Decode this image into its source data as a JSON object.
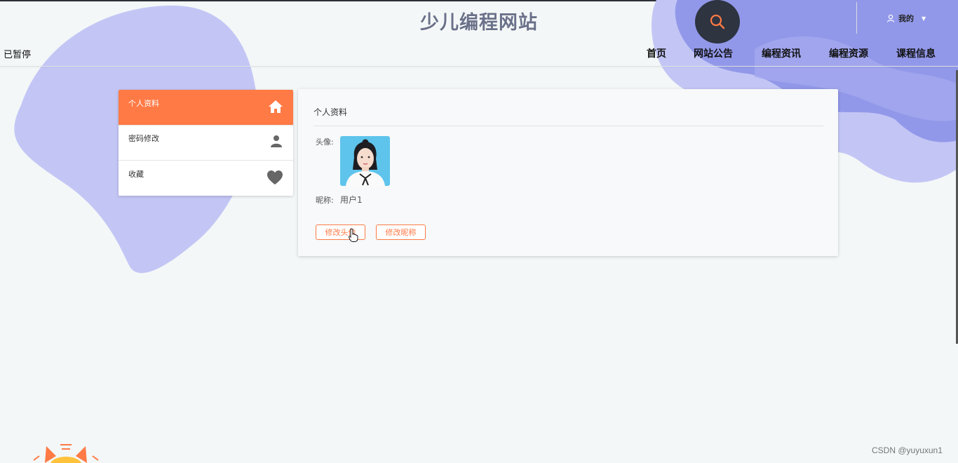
{
  "site": {
    "title": "少儿编程网站"
  },
  "header": {
    "user_label": "我的",
    "status_text": "已暂停"
  },
  "nav": {
    "items": [
      {
        "label": "首页"
      },
      {
        "label": "网站公告"
      },
      {
        "label": "编程资讯"
      },
      {
        "label": "编程资源"
      },
      {
        "label": "课程信息"
      }
    ]
  },
  "sidebar": {
    "items": [
      {
        "label": "个人资料",
        "icon": "home-icon",
        "active": true
      },
      {
        "label": "密码修改",
        "icon": "person-icon",
        "active": false
      },
      {
        "label": "收藏",
        "icon": "heart-icon",
        "active": false
      }
    ]
  },
  "profile": {
    "title": "个人资料",
    "avatar_label": "头像:",
    "nickname_label": "昵称:",
    "nickname_value": "用户1",
    "change_avatar_button": "修改头像",
    "change_nickname_button": "修改昵称"
  },
  "watermark": "CSDN @yuyuxun1",
  "colors": {
    "accent": "#ff7a45",
    "blob": "#c3c6f5",
    "blob_dark": "#8a8fe6",
    "search_bg": "#2e3440"
  }
}
